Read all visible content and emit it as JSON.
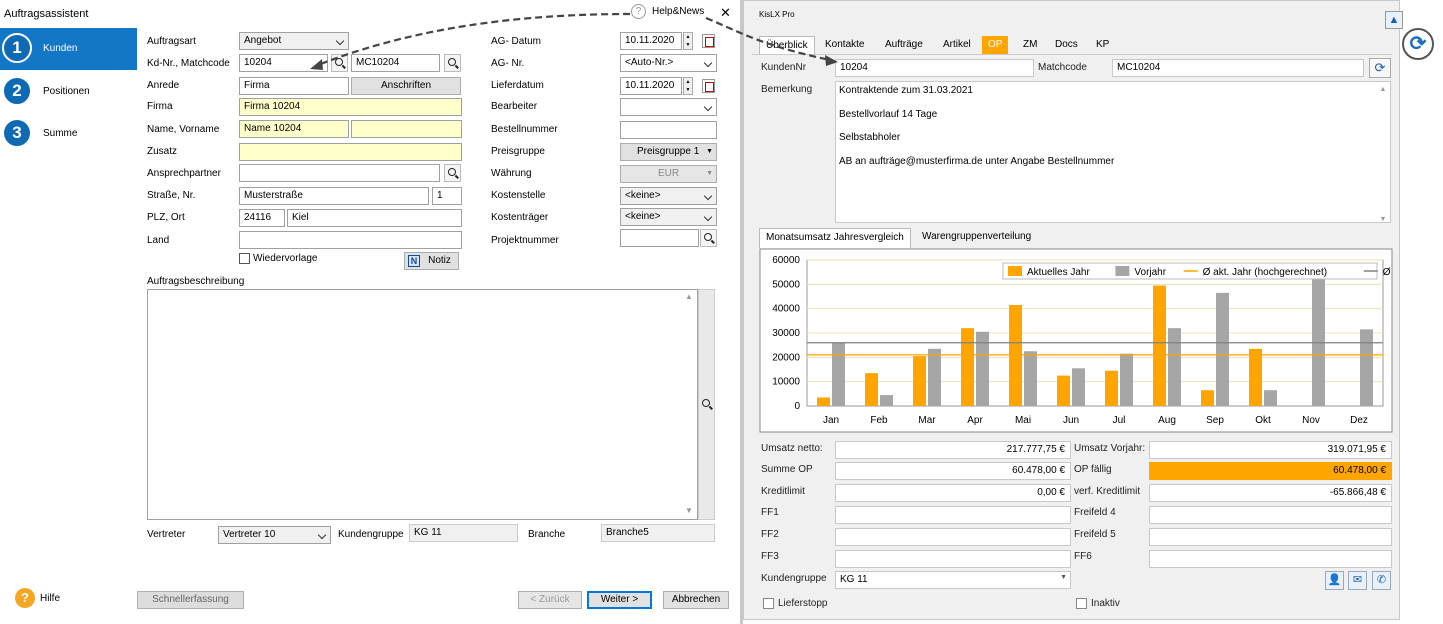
{
  "wizard": {
    "title": "Auftragsassistent",
    "help_news": "Help&News",
    "close": "✕",
    "steps": [
      {
        "num": "1",
        "label": "Kunden"
      },
      {
        "num": "2",
        "label": "Positionen"
      },
      {
        "num": "3",
        "label": "Summe"
      }
    ],
    "labels": {
      "auftragsart": "Auftragsart",
      "kdnr": "Kd-Nr., Matchcode",
      "anrede": "Anrede",
      "firma": "Firma",
      "name": "Name,   Vorname",
      "zusatz": "Zusatz",
      "ansprechpartner": "Ansprechpartner",
      "strasse": "Straße, Nr.",
      "plz": "PLZ,     Ort",
      "land": "Land",
      "wiedervorlage": "Wiedervorlage",
      "beschreibung": "Auftragsbeschreibung",
      "ag_datum": "AG- Datum",
      "ag_nr": "AG- Nr.",
      "lieferdatum": "Lieferdatum",
      "bearbeiter": "Bearbeiter",
      "bestellnummer": "Bestellnummer",
      "preisgruppe": "Preisgruppe",
      "waehrung": "Währung",
      "kostenstelle": "Kostenstelle",
      "kostentraeger": "Kostenträger",
      "projektnummer": "Projektnummer",
      "vertreter": "Vertreter",
      "kundengruppe": "Kundengruppe",
      "branche": "Branche"
    },
    "values": {
      "auftragsart": "Angebot",
      "kdnr": "10204",
      "matchcode": "MC10204",
      "anrede": "Firma",
      "firma": "Firma 10204",
      "name": "Name 10204",
      "vorname": "",
      "zusatz": "",
      "ansprechpartner": "",
      "strasse": "Musterstraße",
      "nr": "1",
      "plz": "24116",
      "ort": "Kiel",
      "land": "",
      "ag_datum": "10.11.2020",
      "ag_nr": "<Auto-Nr.>",
      "lieferdatum": "10.11.2020",
      "bearbeiter": "",
      "bestellnummer": "",
      "preisgruppe": "Preisgruppe 1",
      "waehrung": "EUR",
      "kostenstelle": "<keine>",
      "kostentraeger": "<keine>",
      "projektnummer": "",
      "vertreter": "Vertreter 10",
      "kundengruppe": "KG 11",
      "branche": "Branche5"
    },
    "buttons": {
      "anschriften": "Anschriften",
      "notiz": "Notiz",
      "hilfe": "Hilfe",
      "schnellerfassung": "Schnellerfassung",
      "zurueck": "< Zurück",
      "weiter": "Weiter >",
      "abbrechen": "Abbrechen"
    }
  },
  "kislx": {
    "title": "KisLX Pro",
    "tabs": [
      {
        "label": "Überblick"
      },
      {
        "label": "Kontakte"
      },
      {
        "label": "Aufträge"
      },
      {
        "label": "Artikel"
      },
      {
        "label": "OP"
      },
      {
        "label": "ZM"
      },
      {
        "label": "Docs"
      },
      {
        "label": "KP"
      }
    ],
    "kundennr_label": "KundenNr",
    "kundennr": "10204",
    "matchcode_label": "Matchcode",
    "matchcode": "MC10204",
    "bemerkung_label": "Bemerkung",
    "bemerkung": [
      "Kontraktende zum 31.03.2021",
      "Bestellvorlauf 14 Tage",
      "Selbstabholer",
      "AB an aufträge@musterfirma.de unter Angabe Bestellnummer"
    ],
    "chart_tabs": [
      {
        "label": "Monatsumsatz Jahresvergleich"
      },
      {
        "label": "Warengruppenverteilung"
      }
    ],
    "summary": {
      "umsatz_netto_label": "Umsatz netto:",
      "umsatz_netto": "217.777,75 €",
      "umsatz_vorjahr_label": "Umsatz Vorjahr:",
      "umsatz_vorjahr": "319.071,95 €",
      "summe_op_label": "Summe OP",
      "summe_op": "60.478,00 €",
      "op_faellig_label": "OP fällig",
      "op_faellig": "60.478,00 €",
      "kreditlimit_label": "Kreditlimit",
      "kreditlimit": "0,00 €",
      "verf_kreditlimit_label": "verf. Kreditlimit",
      "verf_kreditlimit": "-65.866,48 €",
      "ff1": "FF1",
      "ff2": "FF2",
      "ff3": "FF3",
      "freifeld4": "Freifeld 4",
      "freifeld5": "Freifeld 5",
      "ff6": "FF6",
      "kundengruppe_label": "Kundengruppe",
      "kundengruppe": "KG 11",
      "lieferstopp": "Lieferstopp",
      "inaktiv": "Inaktiv"
    },
    "accent": "#ffa500"
  },
  "chart_data": {
    "type": "bar",
    "categories": [
      "Jan",
      "Feb",
      "Mar",
      "Apr",
      "Mai",
      "Jun",
      "Jul",
      "Aug",
      "Sep",
      "Okt",
      "Nov",
      "Dez"
    ],
    "series": [
      {
        "name": "Aktuelles Jahr",
        "color": "#ffa500",
        "values": [
          3500,
          13500,
          20500,
          32000,
          41500,
          12500,
          14500,
          49500,
          6500,
          23500,
          0,
          0
        ]
      },
      {
        "name": "Vorjahr",
        "color": "#a6a6a6",
        "values": [
          26000,
          4500,
          23500,
          30500,
          22500,
          15500,
          21500,
          32000,
          46500,
          6500,
          52500,
          31500
        ]
      }
    ],
    "lines": [
      {
        "name": "Ø akt. Jahr (hochgerechnet)",
        "color": "#ffa500",
        "value": 21000
      },
      {
        "name": "Ø Vorjahr",
        "color": "#808080",
        "value": 26000
      }
    ],
    "ylim": [
      0,
      60000
    ],
    "yticks": [
      0,
      10000,
      20000,
      30000,
      40000,
      50000,
      60000
    ],
    "grid": true,
    "legend": "top-right"
  }
}
